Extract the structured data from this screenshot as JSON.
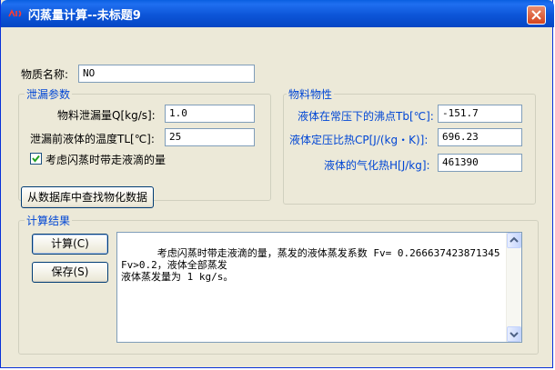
{
  "window": {
    "title": "闪蒸量计算--未标题9"
  },
  "substance": {
    "label": "物质名称:",
    "value": "NO"
  },
  "leak_group": {
    "title": "泄漏参数",
    "flow_label": "物料泄漏量Q[kg/s]:",
    "flow_value": "1.0",
    "temp_label": "泄漏前液体的温度TL[℃]:",
    "temp_value": "25",
    "checkbox_label": "考虑闪蒸时带走液滴的量",
    "checkbox_checked": true
  },
  "props_group": {
    "title": "物料物性",
    "boiling_label": "液体在常压下的沸点Tb[℃]:",
    "boiling_value": "-151.7",
    "cp_label": "液体定压比热CP[J/(kg・K)]:",
    "cp_value": "696.23",
    "vap_label": "液体的气化热H[J/kg]:",
    "vap_value": "461390"
  },
  "lookup_button": {
    "label": "从数据库中查找物化数据"
  },
  "result_group": {
    "title": "计算结果",
    "calc_button": "计算(C)",
    "save_button": "保存(S)",
    "output_text": "考虑闪蒸时带走液滴的量，蒸发的液体蒸发系数 Fv= 0.266637423871345\nFv>0.2，液体全部蒸发\n液体蒸发量为 1 kg/s。"
  },
  "colors": {
    "titlebar": "#0a5fe0",
    "window_bg": "#ece9d8",
    "group_title": "#0046d5"
  }
}
